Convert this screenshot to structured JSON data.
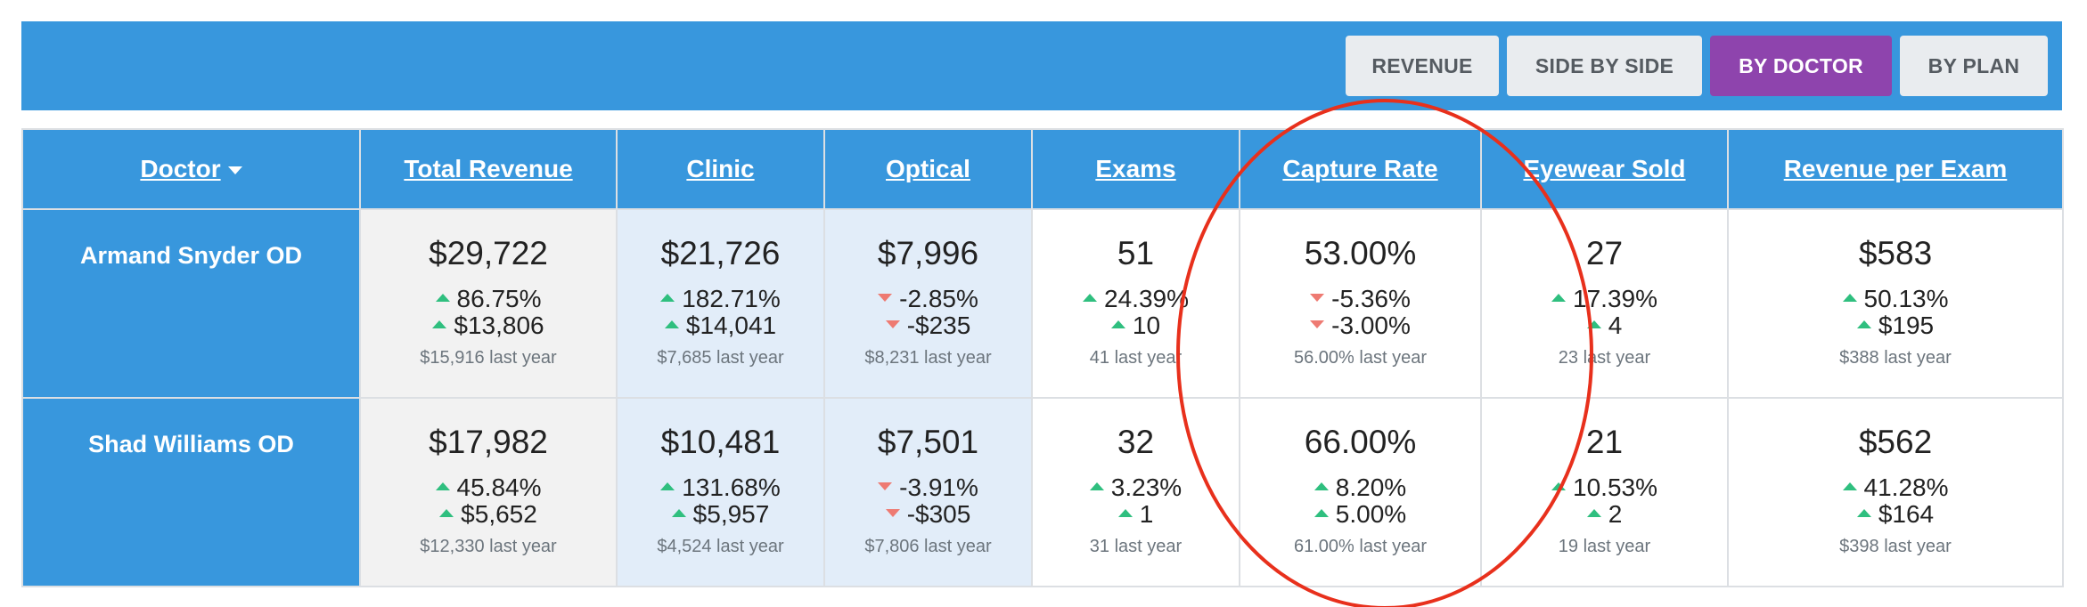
{
  "toolbar": {
    "buttons": [
      {
        "label": "REVENUE",
        "active": false
      },
      {
        "label": "SIDE BY SIDE",
        "active": false
      },
      {
        "label": "BY DOCTOR",
        "active": true
      },
      {
        "label": "BY PLAN",
        "active": false
      }
    ],
    "active_color": "#8e44ad",
    "bar_color": "#3897dd"
  },
  "table": {
    "columns": [
      "Doctor",
      "Total Revenue",
      "Clinic",
      "Optical",
      "Exams",
      "Capture Rate",
      "Eyewear Sold",
      "Revenue per Exam"
    ],
    "sorted_column": "Doctor",
    "sort_direction": "descending",
    "rows": [
      {
        "doctor": "Armand Snyder OD",
        "cells": [
          {
            "main": "$29,722",
            "pct": "86.75%",
            "pct_dir": "up",
            "abs": "$13,806",
            "abs_dir": "up",
            "last": "$15,916 last year"
          },
          {
            "main": "$21,726",
            "pct": "182.71%",
            "pct_dir": "up",
            "abs": "$14,041",
            "abs_dir": "up",
            "last": "$7,685 last year"
          },
          {
            "main": "$7,996",
            "pct": "-2.85%",
            "pct_dir": "down",
            "abs": "-$235",
            "abs_dir": "down",
            "last": "$8,231 last year"
          },
          {
            "main": "51",
            "pct": "24.39%",
            "pct_dir": "up",
            "abs": "10",
            "abs_dir": "up",
            "last": "41 last year"
          },
          {
            "main": "53.00%",
            "pct": "-5.36%",
            "pct_dir": "down",
            "abs": "-3.00%",
            "abs_dir": "down",
            "last": "56.00% last year"
          },
          {
            "main": "27",
            "pct": "17.39%",
            "pct_dir": "up",
            "abs": "4",
            "abs_dir": "up",
            "last": "23 last year"
          },
          {
            "main": "$583",
            "pct": "50.13%",
            "pct_dir": "up",
            "abs": "$195",
            "abs_dir": "up",
            "last": "$388 last year"
          }
        ]
      },
      {
        "doctor": "Shad Williams OD",
        "cells": [
          {
            "main": "$17,982",
            "pct": "45.84%",
            "pct_dir": "up",
            "abs": "$5,652",
            "abs_dir": "up",
            "last": "$12,330 last year"
          },
          {
            "main": "$10,481",
            "pct": "131.68%",
            "pct_dir": "up",
            "abs": "$5,957",
            "abs_dir": "up",
            "last": "$4,524 last year"
          },
          {
            "main": "$7,501",
            "pct": "-3.91%",
            "pct_dir": "down",
            "abs": "-$305",
            "abs_dir": "down",
            "last": "$7,806 last year"
          },
          {
            "main": "32",
            "pct": "3.23%",
            "pct_dir": "up",
            "abs": "1",
            "abs_dir": "up",
            "last": "31 last year"
          },
          {
            "main": "66.00%",
            "pct": "8.20%",
            "pct_dir": "up",
            "abs": "5.00%",
            "abs_dir": "up",
            "last": "61.00% last year"
          },
          {
            "main": "21",
            "pct": "10.53%",
            "pct_dir": "up",
            "abs": "2",
            "abs_dir": "up",
            "last": "19 last year"
          },
          {
            "main": "$562",
            "pct": "41.28%",
            "pct_dir": "up",
            "abs": "$164",
            "abs_dir": "up",
            "last": "$398 last year"
          }
        ]
      }
    ],
    "colors": {
      "header": "#3897dd",
      "up": "#2fbf7f",
      "down": "#ee7a72",
      "total_bg": "#f2f2f2",
      "clinic_optical_bg": "#e2edf9"
    }
  },
  "annotation": {
    "shape": "ellipse",
    "color": "#e8301c",
    "encloses_column": "Capture Rate"
  }
}
